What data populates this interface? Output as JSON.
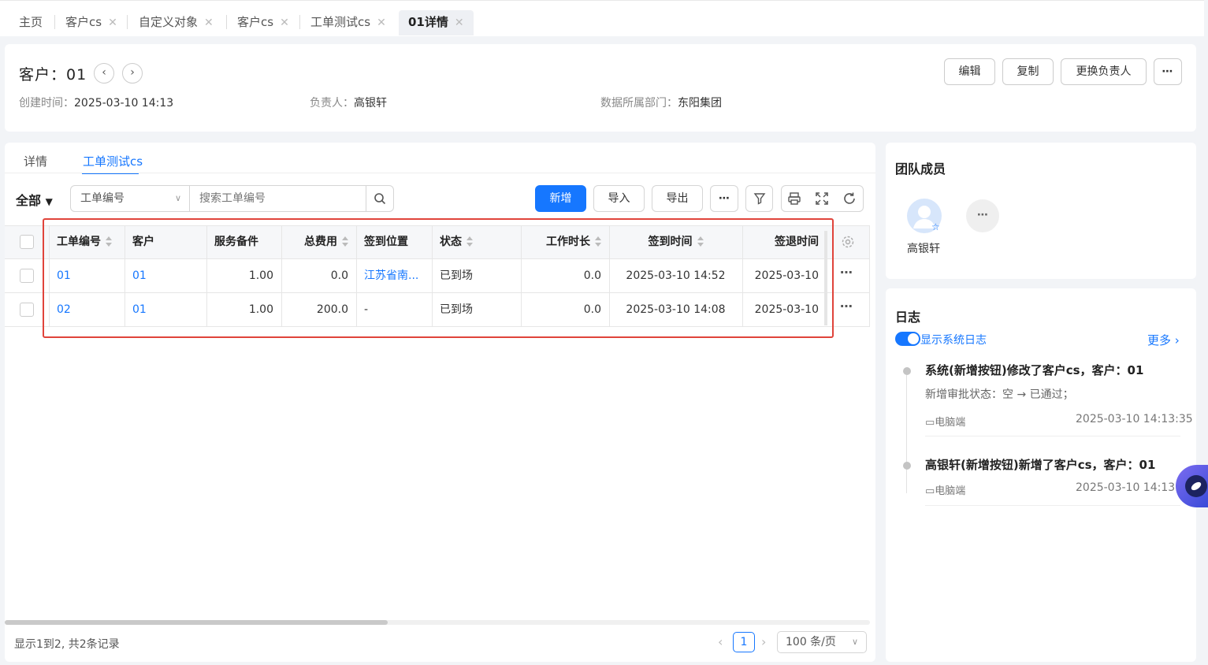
{
  "tabs": [
    {
      "label": "主页",
      "closable": false
    },
    {
      "label": "客户cs",
      "closable": true
    },
    {
      "label": "自定义对象",
      "closable": true
    },
    {
      "label": "客户cs",
      "closable": true
    },
    {
      "label": "工单测试cs",
      "closable": true
    },
    {
      "label": "01详情",
      "closable": true,
      "active": true
    }
  ],
  "header": {
    "title_prefix": "客户：",
    "title_value": "01",
    "created_label": "创建时间：",
    "created_value": "2025-03-10 14:13",
    "owner_label": "负责人：",
    "owner_value": "高银轩",
    "dept_label": "数据所属部门：",
    "dept_value": "东阳集团",
    "buttons": {
      "edit": "编辑",
      "copy": "复制",
      "change_owner": "更换负责人"
    }
  },
  "subtabs": {
    "detail": "详情",
    "related": "工单测试cs"
  },
  "toolbar": {
    "scope": "全部",
    "field_select": "工单编号",
    "search_placeholder": "搜索工单编号",
    "add": "新增",
    "import": "导入",
    "export": "导出"
  },
  "table": {
    "columns": [
      "工单编号",
      "客户",
      "服务备件",
      "总费用",
      "签到位置",
      "状态",
      "工作时长",
      "签到时间",
      "签退时间"
    ],
    "rows": [
      {
        "no": "01",
        "customer": "01",
        "parts": "1.00",
        "fee": "0.0",
        "location": "江苏省南...",
        "status": "已到场",
        "duration": "0.0",
        "checkin": "2025-03-10 14:52",
        "checkout": "2025-03-10"
      },
      {
        "no": "02",
        "customer": "01",
        "parts": "1.00",
        "fee": "200.0",
        "location": "-",
        "status": "已到场",
        "duration": "0.0",
        "checkin": "2025-03-10 14:08",
        "checkout": "2025-03-10"
      }
    ]
  },
  "footer": {
    "summary": "显示1到2, 共2条记录",
    "current_page": "1",
    "page_size": "100 条/页"
  },
  "team": {
    "title": "团队成员",
    "member": "高银轩"
  },
  "log": {
    "title": "日志",
    "toggle_label": "显示系统日志",
    "more": "更多",
    "entries": [
      {
        "title": "系统(新增按钮)修改了客户cs，客户：01",
        "detail": "新增审批状态：空 → 已通过；",
        "source": "电脑端",
        "time": "2025-03-10 14:13:35"
      },
      {
        "title": "高银轩(新增按钮)新增了客户cs，客户：01",
        "source": "电脑端",
        "time": "2025-03-10 14:13:3"
      }
    ]
  },
  "colors": {
    "accent": "#1677ff",
    "highlight_box": "#e0443b"
  }
}
